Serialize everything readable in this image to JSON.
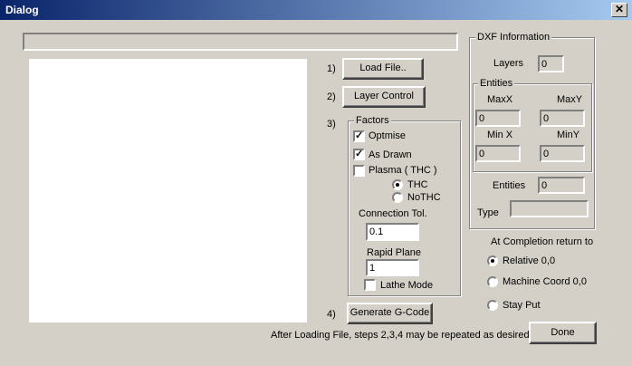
{
  "window": {
    "title": "Dialog",
    "close_glyph": "✕"
  },
  "steps": {
    "s1": "1)",
    "load_file": "Load File..",
    "s2": "2)",
    "layer_control": "Layer Control",
    "s3": "3)",
    "s4": "4)",
    "generate": "Generate G-Code"
  },
  "factors": {
    "legend": "Factors",
    "optimise": {
      "label": "Optmise",
      "checked": true
    },
    "as_drawn": {
      "label": "As Drawn",
      "checked": true
    },
    "plasma": {
      "label": "Plasma ( THC )",
      "checked": false
    },
    "thc": {
      "label": "THC",
      "selected": true
    },
    "nothc": {
      "label": "NoTHC",
      "selected": false
    },
    "connection_tol": {
      "label": "Connection Tol.",
      "value": "0.1"
    },
    "rapid_plane": {
      "label": "Rapid Plane",
      "value": "1"
    },
    "lathe_mode": {
      "label": "Lathe Mode",
      "checked": false
    }
  },
  "dxf": {
    "legend": "DXF Information",
    "layers_label": "Layers",
    "layers_value": "0",
    "entities_group": "Entities",
    "maxx_label": "MaxX",
    "maxx_value": "0",
    "maxy_label": "MaxY",
    "maxy_value": "0",
    "minx_label": "Min X",
    "minx_value": "0",
    "miny_label": "MinY",
    "miny_value": "0",
    "entities_label": "Entities",
    "entities_value": "0",
    "type_label": "Type",
    "type_value": ""
  },
  "completion": {
    "title": "At Completion return to",
    "relative": "Relative 0,0",
    "machine": "Machine Coord 0,0",
    "stay": "Stay Put",
    "selected": "relative"
  },
  "footer": {
    "note": "After Loading File, steps 2,3,4 may be repeated as desired.",
    "done": "Done"
  }
}
